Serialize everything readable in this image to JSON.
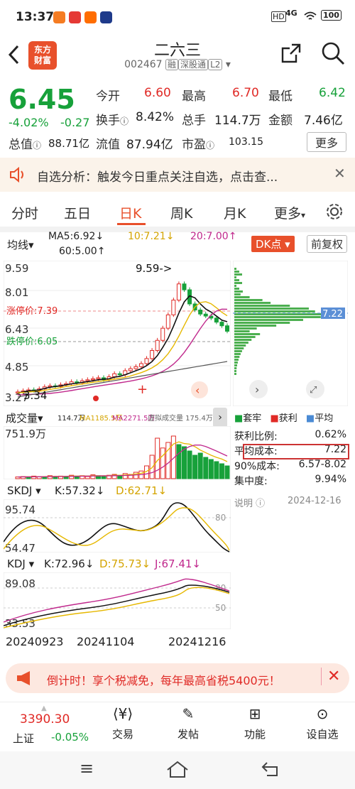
{
  "status_bar": {
    "time": "13:37",
    "battery": "100",
    "network": "4G"
  },
  "header": {
    "title": "二六三",
    "code": "002467",
    "tags": [
      "融",
      "深股通",
      "L2"
    ],
    "logo": [
      "东方",
      "财富"
    ]
  },
  "quote": {
    "price": "6.45",
    "change_pct": "-4.02%",
    "change": "-0.27",
    "open_label": "今开",
    "open": "6.60",
    "high_label": "最高",
    "high": "6.70",
    "low_label": "最低",
    "low": "6.42",
    "turnover_label": "换手",
    "turnover": "8.42%",
    "volume_label": "总手",
    "volume": "114.7万",
    "amount_label": "金额",
    "amount": "7.46亿",
    "mktcap_label": "总值",
    "mktcap": "88.71亿",
    "float_label": "流值",
    "float": "87.94亿",
    "pe_label": "市盈",
    "pe": "103.15",
    "more_label": "更多"
  },
  "notice": {
    "text": "自选分析：触发今日重点关注自选，点击查..."
  },
  "tabs": [
    "分时",
    "五日",
    "日K",
    "周K",
    "月K",
    "更多"
  ],
  "ma_bar": {
    "ma_label": "均线",
    "ma5": "MA5:6.92↓",
    "ma10": "10:7.21↓",
    "ma20": "20:7.00↑",
    "ma60": "60:5.00↑",
    "dk": "DK点",
    "adjust": "前复权"
  },
  "kline": {
    "y_labels": [
      "9.59",
      "8.01",
      "6.43",
      "4.85",
      "3.27"
    ],
    "high_marker": "9.59->",
    "low_marker": "3.34",
    "limit_up": "涨停价:7.39",
    "limit_down": "跌停价:6.05",
    "closes": [
      3.45,
      3.5,
      3.55,
      3.52,
      3.6,
      3.7,
      3.75,
      3.72,
      3.8,
      3.85,
      3.95,
      3.9,
      4.0,
      4.05,
      4.1,
      4.15,
      4.05,
      4.2,
      4.35,
      4.3,
      4.5,
      4.6,
      4.7,
      4.85,
      5.1,
      5.5,
      6.0,
      6.6,
      7.26,
      7.99,
      8.79,
      8.5,
      7.8,
      7.5,
      7.3,
      7.2,
      7.1,
      6.9,
      6.72,
      6.45
    ],
    "ma5_line": [
      3.4,
      3.45,
      3.5,
      3.52,
      3.55,
      3.62,
      3.68,
      3.72,
      3.75,
      3.8,
      3.85,
      3.88,
      3.92,
      3.96,
      4.0,
      4.05,
      4.08,
      4.1,
      4.18,
      4.22,
      4.3,
      4.4,
      4.5,
      4.6,
      4.75,
      4.95,
      5.25,
      5.65,
      6.1,
      6.7,
      7.35,
      7.9,
      8.2,
      8.1,
      7.8,
      7.55,
      7.4,
      7.2,
      7.0,
      6.92
    ]
  },
  "chip": {
    "price": "7.22",
    "legend": [
      "套牢",
      "获利",
      "平均"
    ],
    "rows": [
      [
        "获利比例:",
        "0.62%"
      ],
      [
        "平均成本:",
        "7.22"
      ],
      [
        "90%成本:",
        "6.57-8.02"
      ],
      [
        "集中度:",
        "9.94%"
      ]
    ],
    "note": "说明",
    "date": "2024-12-16"
  },
  "volume": {
    "label": "成交量",
    "v": "114.7万",
    "ma1": "MA1185.5万",
    "ma2": "MA2271.5万",
    "extra": "虚拟成交量 175.4万",
    "max": "751.9万",
    "bars": [
      0.04,
      0.05,
      0.04,
      0.06,
      0.05,
      0.04,
      0.07,
      0.05,
      0.06,
      0.05,
      0.08,
      0.06,
      0.07,
      0.05,
      0.09,
      0.07,
      0.06,
      0.08,
      0.1,
      0.08,
      0.12,
      0.1,
      0.15,
      0.18,
      0.3,
      0.55,
      0.95,
      0.72,
      0.85,
      1.0,
      0.8,
      0.75,
      0.65,
      0.55,
      0.6,
      0.5,
      0.45,
      0.4,
      0.35,
      0.3
    ],
    "up": [
      1,
      1,
      0,
      1,
      1,
      0,
      1,
      0,
      1,
      0,
      1,
      0,
      1,
      1,
      1,
      0,
      0,
      1,
      1,
      0,
      1,
      1,
      1,
      1,
      1,
      1,
      1,
      1,
      1,
      1,
      0,
      0,
      0,
      0,
      0,
      0,
      0,
      0,
      0,
      0
    ]
  },
  "skdj": {
    "label": "SKDJ",
    "k": "K:57.32↓",
    "d": "D:62.71↓",
    "top": "95.74",
    "bottom": "54.47",
    "ref": "80"
  },
  "kdj": {
    "label": "KDJ",
    "k": "K:72.96↓",
    "d": "D:75.73↓",
    "j": "J:67.41↓",
    "top": "89.08",
    "bottom": "33.53",
    "ref1": "80",
    "ref2": "50"
  },
  "dates": [
    "20240923",
    "20241104",
    "20241216"
  ],
  "promo": {
    "text": "倒计时！享个税减免，每年最高省税5400元！"
  },
  "bottom": {
    "index_value": "3390.30",
    "index_name": "上证",
    "index_change": "-0.05%",
    "items": [
      "交易",
      "发帖",
      "功能",
      "设自选"
    ]
  },
  "colors": {
    "accent": "#e8502b",
    "up": "#e02a26",
    "down": "#17a13a",
    "ma10": "#e6b800",
    "ma20": "#c0288c"
  }
}
